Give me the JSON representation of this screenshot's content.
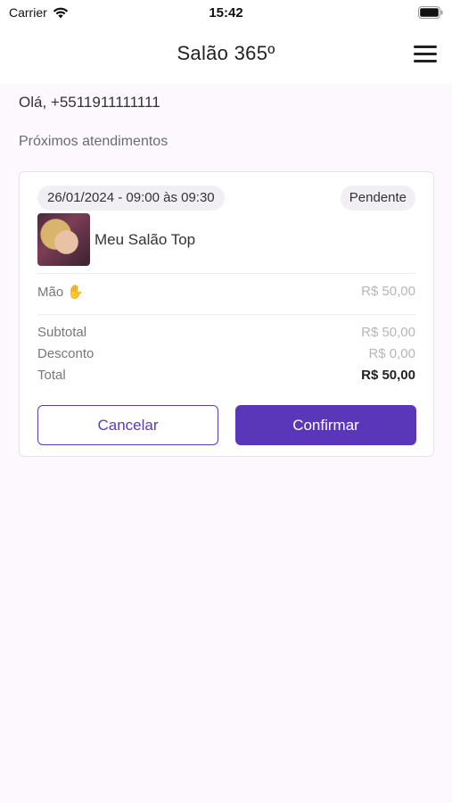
{
  "status_bar": {
    "carrier": "Carrier",
    "time": "15:42"
  },
  "header": {
    "title": "Salão 365º"
  },
  "greeting": "Olá, +5511911111111",
  "section_title": "Próximos atendimentos",
  "appointment": {
    "datetime": "26/01/2024 - 09:00 às 09:30",
    "status": "Pendente",
    "salon_name": "Meu Salão Top",
    "service": {
      "name": "Mão ✋",
      "price": "R$ 50,00"
    },
    "summary": {
      "subtotal_label": "Subtotal",
      "subtotal": "R$ 50,00",
      "discount_label": "Desconto",
      "discount": "R$ 0,00",
      "total_label": "Total",
      "total": "R$ 50,00"
    },
    "cancel_label": "Cancelar",
    "confirm_label": "Confirmar"
  },
  "colors": {
    "accent": "#5a37b8",
    "background": "#fcf8fd"
  },
  "icons": [
    "wifi-icon",
    "battery-icon",
    "menu-icon"
  ]
}
